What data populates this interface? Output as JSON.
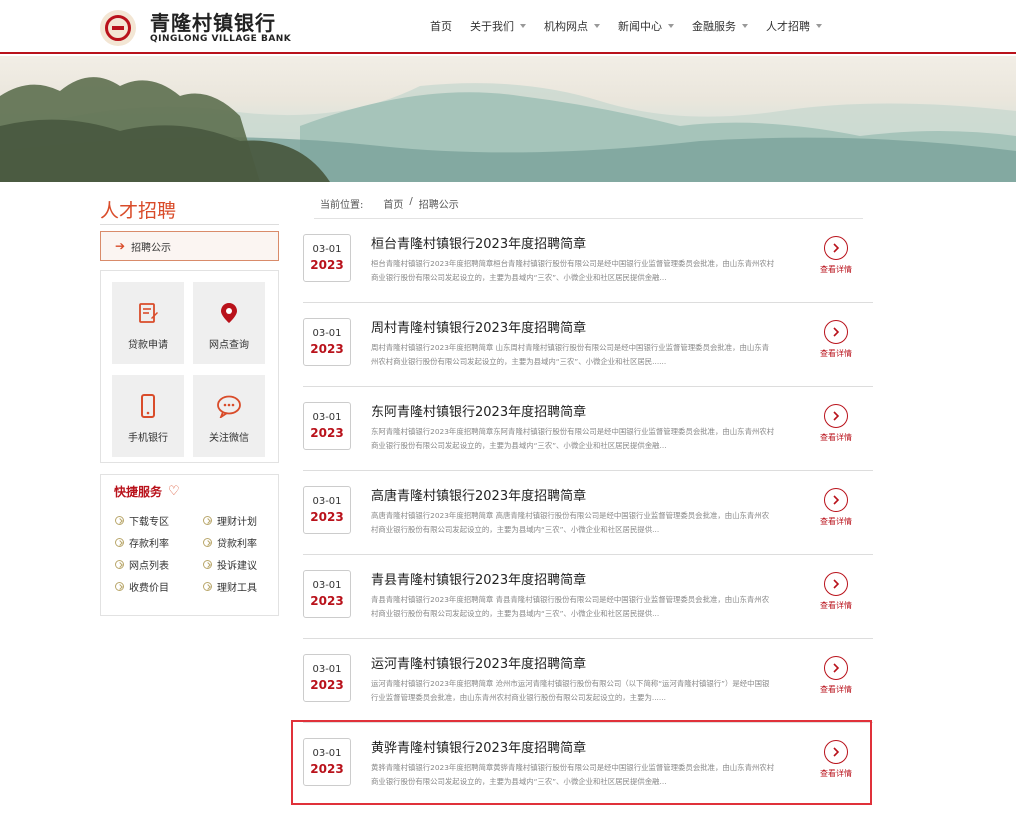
{
  "header": {
    "logo_cn": "青隆村镇银行",
    "logo_en": "QINGLONG VILLAGE BANK",
    "nav": [
      {
        "label": "首页",
        "dropdown": false
      },
      {
        "label": "关于我们",
        "dropdown": true
      },
      {
        "label": "机构网点",
        "dropdown": true
      },
      {
        "label": "新闻中心",
        "dropdown": true
      },
      {
        "label": "金融服务",
        "dropdown": true
      },
      {
        "label": "人才招聘",
        "dropdown": true
      }
    ]
  },
  "sidebar": {
    "title": "人才招聘",
    "active_item": "招聘公示",
    "tiles": [
      {
        "label": "贷款申请",
        "icon": "loan-form-icon"
      },
      {
        "label": "网点查询",
        "icon": "location-pin-icon"
      },
      {
        "label": "手机银行",
        "icon": "mobile-phone-icon"
      },
      {
        "label": "关注微信",
        "icon": "wechat-chat-icon"
      }
    ],
    "quick": {
      "title": "快捷服务",
      "items": [
        "下载专区",
        "理财计划",
        "存款利率",
        "贷款利率",
        "网点列表",
        "投诉建议",
        "收费价目",
        "理财工具"
      ]
    }
  },
  "breadcrumb": {
    "prefix": "当前位置:",
    "home": "首页",
    "sep": "/",
    "current": "招聘公示"
  },
  "articles": [
    {
      "md": "03-01",
      "year": "2023",
      "title": "桓台青隆村镇银行2023年度招聘简章",
      "summary": "桓台青隆村镇银行2023年度招聘简章桓台青隆村镇银行股份有限公司是经中国银行业监督管理委员会批准，由山东青州农村商业银行股份有限公司发起设立的，主要为县域内“三农”、小微企业和社区居民提供金融...",
      "more": "查看详情"
    },
    {
      "md": "03-01",
      "year": "2023",
      "title": "周村青隆村镇银行2023年度招聘简章",
      "summary": "周村青隆村镇银行2023年度招聘简章 山东周村青隆村镇银行股份有限公司是经中国银行业监督管理委员会批准，由山东青州农村商业银行股份有限公司发起设立的，主要为县域内“三农”、小微企业和社区居民......",
      "more": "查看详情"
    },
    {
      "md": "03-01",
      "year": "2023",
      "title": "东阿青隆村镇银行2023年度招聘简章",
      "summary": "东阿青隆村镇银行2023年度招聘简章东阿青隆村镇银行股份有限公司是经中国银行业监督管理委员会批准，由山东青州农村商业银行股份有限公司发起设立的，主要为县域内“三农”、小微企业和社区居民提供金融...",
      "more": "查看详情"
    },
    {
      "md": "03-01",
      "year": "2023",
      "title": "高唐青隆村镇银行2023年度招聘简章",
      "summary": "高唐青隆村镇银行2023年度招聘简章 高唐青隆村镇银行股份有限公司是经中国银行业监督管理委员会批准，由山东青州农村商业银行股份有限公司发起设立的，主要为县域内“三农”、小微企业和社区居民提供...",
      "more": "查看详情"
    },
    {
      "md": "03-01",
      "year": "2023",
      "title": "青县青隆村镇银行2023年度招聘简章",
      "summary": "青县青隆村镇银行2023年度招聘简章 青县青隆村镇银行股份有限公司是经中国银行业监督管理委员会批准，由山东青州农村商业银行股份有限公司发起设立的，主要为县域内“三农”、小微企业和社区居民提供...",
      "more": "查看详情"
    },
    {
      "md": "03-01",
      "year": "2023",
      "title": "运河青隆村镇银行2023年度招聘简章",
      "summary": "运河青隆村镇银行2023年度招聘简章 沧州市运河青隆村镇银行股份有限公司（以下简称“运河青隆村镇银行”）是经中国银行业监督管理委员会批准，由山东青州农村商业银行股份有限公司发起设立的，主要为......",
      "more": "查看详情"
    },
    {
      "md": "03-01",
      "year": "2023",
      "title": "黄骅青隆村镇银行2023年度招聘简章",
      "summary": "黄骅青隆村镇银行2023年度招聘简章黄骅青隆村镇银行股份有限公司是经中国银行业监督管理委员会批准，由山东青州农村商业银行股份有限公司发起设立的，主要为县域内“三农”、小微企业和社区居民提供金融...",
      "more": "查看详情"
    }
  ],
  "colors": {
    "brand_red": "#b9121b",
    "accent_orange": "#d94c2a",
    "highlight_border": "#e0313a"
  }
}
